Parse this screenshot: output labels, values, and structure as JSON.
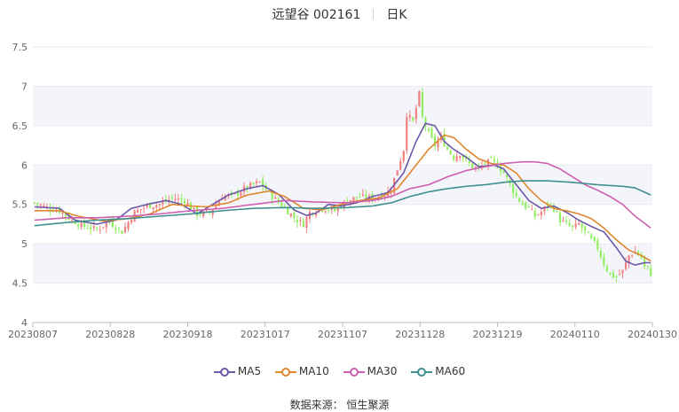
{
  "header": {
    "stock": "远望谷 002161",
    "period": "日K"
  },
  "source_text": "数据来源： 恒生聚源",
  "colors": {
    "up": "#f08080",
    "down": "#90ee60",
    "grid": "#eaeaea",
    "band": "#f4f5fb",
    "axis": "#999999"
  },
  "chart_data": {
    "type": "candlestick",
    "title": "远望谷 002161 日K",
    "ylim": [
      4,
      7.5
    ],
    "yticks": [
      "4",
      "4.5",
      "5",
      "5.5",
      "6",
      "6.5",
      "7",
      "7.5"
    ],
    "xtick_labels": [
      "20230807",
      "20230828",
      "20230918",
      "20231017",
      "20231107",
      "20231128",
      "20231219",
      "20240110",
      "20240130"
    ],
    "legend_position": "bottom-center",
    "series": [
      {
        "name": "MA5",
        "color": "#6b58a8",
        "key": "ma5"
      },
      {
        "name": "MA10",
        "color": "#e0862f",
        "key": "ma10"
      },
      {
        "name": "MA30",
        "color": "#cc5fb0",
        "key": "ma30"
      },
      {
        "name": "MA60",
        "color": "#3f8f8f",
        "key": "ma60"
      }
    ],
    "ma5": [
      [
        0,
        5.47
      ],
      [
        8,
        5.45
      ],
      [
        13,
        5.3
      ],
      [
        20,
        5.25
      ],
      [
        26,
        5.3
      ],
      [
        31,
        5.45
      ],
      [
        36,
        5.5
      ],
      [
        42,
        5.55
      ],
      [
        47,
        5.5
      ],
      [
        52,
        5.38
      ],
      [
        57,
        5.5
      ],
      [
        62,
        5.62
      ],
      [
        68,
        5.7
      ],
      [
        73,
        5.74
      ],
      [
        78,
        5.63
      ],
      [
        83,
        5.43
      ],
      [
        87,
        5.36
      ],
      [
        90,
        5.39
      ],
      [
        94,
        5.5
      ],
      [
        98,
        5.48
      ],
      [
        103,
        5.52
      ],
      [
        108,
        5.6
      ],
      [
        113,
        5.65
      ],
      [
        118,
        5.9
      ],
      [
        122,
        6.3
      ],
      [
        125,
        6.53
      ],
      [
        128,
        6.5
      ],
      [
        131,
        6.3
      ],
      [
        134,
        6.2
      ],
      [
        138,
        6.1
      ],
      [
        142,
        5.98
      ],
      [
        147,
        6.0
      ],
      [
        150,
        5.95
      ],
      [
        154,
        5.75
      ],
      [
        158,
        5.55
      ],
      [
        162,
        5.45
      ],
      [
        166,
        5.48
      ],
      [
        170,
        5.4
      ],
      [
        174,
        5.3
      ],
      [
        178,
        5.22
      ],
      [
        182,
        5.15
      ],
      [
        186,
        4.95
      ],
      [
        189,
        4.78
      ],
      [
        192,
        4.73
      ],
      [
        195,
        4.76
      ],
      [
        197,
        4.76
      ]
    ],
    "ma10": [
      [
        0,
        5.42
      ],
      [
        8,
        5.42
      ],
      [
        14,
        5.35
      ],
      [
        22,
        5.29
      ],
      [
        30,
        5.32
      ],
      [
        37,
        5.38
      ],
      [
        44,
        5.5
      ],
      [
        50,
        5.48
      ],
      [
        55,
        5.47
      ],
      [
        62,
        5.52
      ],
      [
        68,
        5.62
      ],
      [
        75,
        5.67
      ],
      [
        80,
        5.6
      ],
      [
        86,
        5.45
      ],
      [
        92,
        5.43
      ],
      [
        98,
        5.5
      ],
      [
        104,
        5.55
      ],
      [
        110,
        5.58
      ],
      [
        116,
        5.7
      ],
      [
        121,
        5.95
      ],
      [
        126,
        6.2
      ],
      [
        131,
        6.38
      ],
      [
        134,
        6.35
      ],
      [
        138,
        6.2
      ],
      [
        142,
        6.08
      ],
      [
        146,
        6.02
      ],
      [
        150,
        6.0
      ],
      [
        154,
        5.9
      ],
      [
        158,
        5.7
      ],
      [
        162,
        5.55
      ],
      [
        166,
        5.45
      ],
      [
        170,
        5.42
      ],
      [
        174,
        5.38
      ],
      [
        178,
        5.32
      ],
      [
        182,
        5.2
      ],
      [
        186,
        5.05
      ],
      [
        190,
        4.92
      ],
      [
        194,
        4.85
      ],
      [
        197,
        4.78
      ]
    ],
    "ma30": [
      [
        0,
        5.3
      ],
      [
        10,
        5.33
      ],
      [
        20,
        5.33
      ],
      [
        30,
        5.35
      ],
      [
        40,
        5.38
      ],
      [
        50,
        5.42
      ],
      [
        60,
        5.45
      ],
      [
        70,
        5.5
      ],
      [
        80,
        5.55
      ],
      [
        90,
        5.53
      ],
      [
        100,
        5.52
      ],
      [
        108,
        5.55
      ],
      [
        114,
        5.6
      ],
      [
        120,
        5.7
      ],
      [
        126,
        5.75
      ],
      [
        132,
        5.85
      ],
      [
        138,
        5.93
      ],
      [
        144,
        5.98
      ],
      [
        150,
        6.02
      ],
      [
        156,
        6.04
      ],
      [
        160,
        6.04
      ],
      [
        164,
        6.02
      ],
      [
        168,
        5.95
      ],
      [
        172,
        5.85
      ],
      [
        176,
        5.75
      ],
      [
        180,
        5.68
      ],
      [
        184,
        5.6
      ],
      [
        188,
        5.5
      ],
      [
        192,
        5.35
      ],
      [
        197,
        5.2
      ]
    ],
    "ma60": [
      [
        0,
        5.23
      ],
      [
        10,
        5.27
      ],
      [
        20,
        5.3
      ],
      [
        30,
        5.32
      ],
      [
        40,
        5.35
      ],
      [
        50,
        5.38
      ],
      [
        60,
        5.42
      ],
      [
        70,
        5.45
      ],
      [
        80,
        5.46
      ],
      [
        90,
        5.45
      ],
      [
        100,
        5.46
      ],
      [
        108,
        5.48
      ],
      [
        114,
        5.52
      ],
      [
        120,
        5.6
      ],
      [
        126,
        5.66
      ],
      [
        132,
        5.7
      ],
      [
        138,
        5.73
      ],
      [
        144,
        5.75
      ],
      [
        150,
        5.78
      ],
      [
        156,
        5.8
      ],
      [
        164,
        5.8
      ],
      [
        172,
        5.78
      ],
      [
        180,
        5.75
      ],
      [
        188,
        5.73
      ],
      [
        192,
        5.71
      ],
      [
        197,
        5.62
      ]
    ],
    "candle_anchors": [
      [
        0,
        5.52
      ],
      [
        4,
        5.46
      ],
      [
        8,
        5.42
      ],
      [
        12,
        5.3
      ],
      [
        16,
        5.22
      ],
      [
        20,
        5.18
      ],
      [
        24,
        5.28
      ],
      [
        28,
        5.15
      ],
      [
        32,
        5.4
      ],
      [
        36,
        5.48
      ],
      [
        40,
        5.5
      ],
      [
        44,
        5.58
      ],
      [
        48,
        5.55
      ],
      [
        52,
        5.38
      ],
      [
        56,
        5.4
      ],
      [
        60,
        5.6
      ],
      [
        64,
        5.62
      ],
      [
        68,
        5.72
      ],
      [
        72,
        5.78
      ],
      [
        76,
        5.6
      ],
      [
        80,
        5.45
      ],
      [
        84,
        5.3
      ],
      [
        86,
        5.25
      ],
      [
        88,
        5.4
      ],
      [
        92,
        5.45
      ],
      [
        96,
        5.42
      ],
      [
        100,
        5.55
      ],
      [
        104,
        5.6
      ],
      [
        108,
        5.58
      ],
      [
        112,
        5.62
      ],
      [
        114,
        5.7
      ],
      [
        116,
        5.95
      ],
      [
        118,
        6.2
      ],
      [
        119,
        6.65
      ],
      [
        121,
        6.55
      ],
      [
        123,
        6.9
      ],
      [
        124,
        6.6
      ],
      [
        126,
        6.4
      ],
      [
        128,
        6.25
      ],
      [
        130,
        6.35
      ],
      [
        132,
        6.2
      ],
      [
        134,
        6.1
      ],
      [
        136,
        6.15
      ],
      [
        138,
        6.05
      ],
      [
        140,
        5.98
      ],
      [
        142,
        5.95
      ],
      [
        144,
        6.02
      ],
      [
        146,
        6.05
      ],
      [
        148,
        6.0
      ],
      [
        150,
        5.9
      ],
      [
        152,
        5.75
      ],
      [
        154,
        5.6
      ],
      [
        156,
        5.5
      ],
      [
        158,
        5.45
      ],
      [
        160,
        5.35
      ],
      [
        162,
        5.4
      ],
      [
        164,
        5.5
      ],
      [
        166,
        5.45
      ],
      [
        168,
        5.3
      ],
      [
        170,
        5.25
      ],
      [
        172,
        5.2
      ],
      [
        174,
        5.25
      ],
      [
        176,
        5.15
      ],
      [
        178,
        5.05
      ],
      [
        180,
        4.95
      ],
      [
        182,
        4.75
      ],
      [
        184,
        4.6
      ],
      [
        186,
        4.58
      ],
      [
        188,
        4.65
      ],
      [
        190,
        4.85
      ],
      [
        192,
        4.9
      ],
      [
        194,
        4.82
      ],
      [
        195,
        4.7
      ],
      [
        196,
        4.68
      ],
      [
        197,
        4.62
      ]
    ]
  }
}
